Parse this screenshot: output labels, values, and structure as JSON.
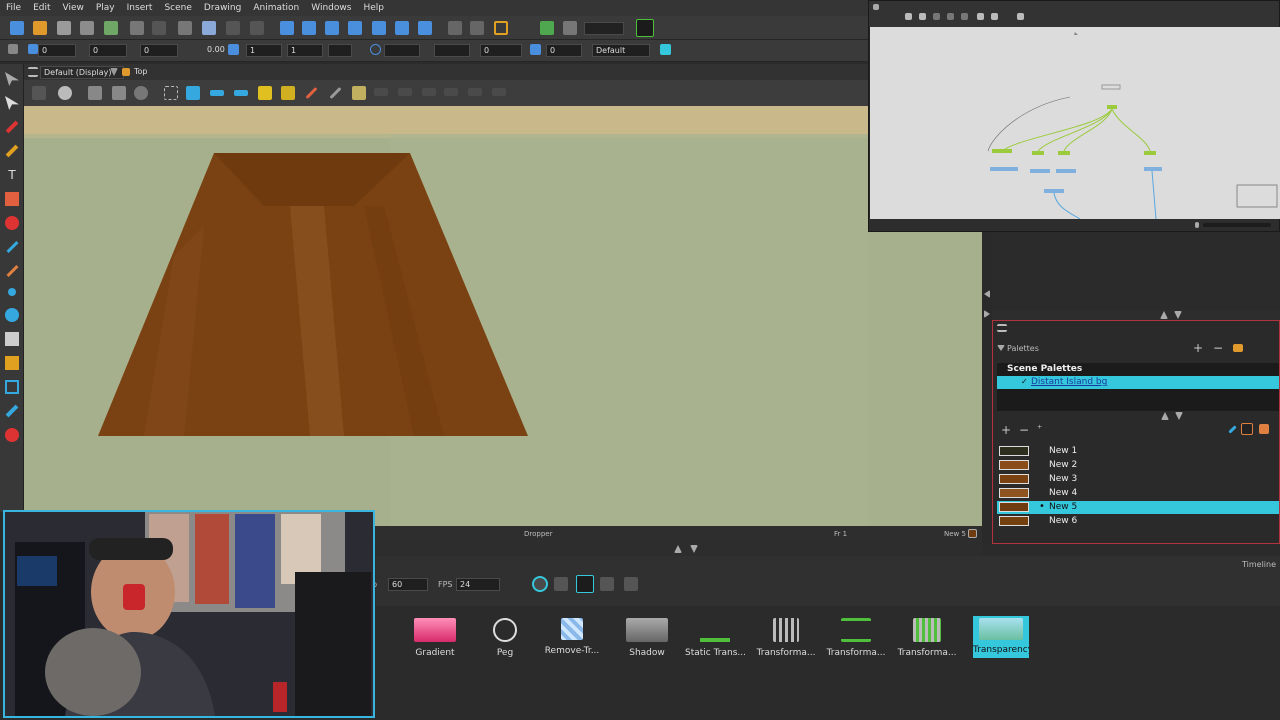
{
  "menu": [
    "File",
    "Edit",
    "View",
    "Play",
    "Insert",
    "Scene",
    "Drawing",
    "Animation",
    "Windows",
    "Help"
  ],
  "toolbar2": {
    "fields": [
      "0",
      "0",
      "0",
      "0.00",
      "1",
      "1",
      "0",
      "0",
      "0"
    ],
    "display_select": "Default"
  },
  "viewport": {
    "display_select": "Default (Display)",
    "breadcrumb": "Top",
    "status_tool": "Dropper",
    "status_frame": "Fr 1",
    "status_color": "New 5"
  },
  "palettes": {
    "header": "Palettes",
    "scene_palettes_title": "Scene Palettes",
    "selected_palette": "Distant Island bg",
    "colors": [
      {
        "name": "New 1",
        "hex": "#2e2e1e",
        "selected": false
      },
      {
        "name": "New 2",
        "hex": "#8a4d1a",
        "selected": false
      },
      {
        "name": "New 3",
        "hex": "#7a4212",
        "selected": false
      },
      {
        "name": "New 4",
        "hex": "#8e5420",
        "selected": false
      },
      {
        "name": "New 5",
        "hex": "#6e3c10",
        "selected": true
      },
      {
        "name": "New 6",
        "hex": "#74400e",
        "selected": false
      }
    ]
  },
  "playback": {
    "end_frame": "60",
    "fps_label": "FPS",
    "fps": "24",
    "timeline_tab": "Timeline"
  },
  "library": {
    "effects": [
      {
        "label": "Gradient",
        "icon": "gradient-icon"
      },
      {
        "label": "Peg",
        "icon": "peg-icon"
      },
      {
        "label": "Remove-Tr...",
        "icon": "remove-transparency-icon"
      },
      {
        "label": "Shadow",
        "icon": "shadow-icon"
      },
      {
        "label": "Static Trans...",
        "icon": "static-transform-icon"
      },
      {
        "label": "Transforma...",
        "icon": "transformation-icon"
      },
      {
        "label": "Transforma...",
        "icon": "transformation-gate-icon"
      },
      {
        "label": "Transforma...",
        "icon": "transformation-limit-icon"
      },
      {
        "label": "Transparency",
        "icon": "transparency-icon"
      }
    ]
  },
  "colors": {
    "accent": "#35c8dc",
    "background_fill": "#a2ac88",
    "table_brown": "#7a4212",
    "sky_band": "#c8b88a"
  }
}
